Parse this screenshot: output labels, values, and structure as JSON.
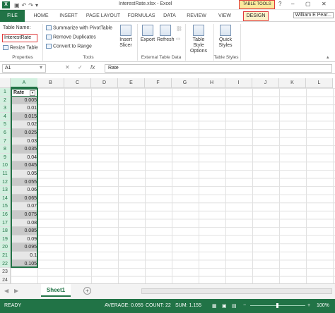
{
  "window": {
    "title": "InterestRate.xlsx - Excel",
    "contextual_tab": "TABLE TOOLS",
    "controls": [
      "?",
      "–",
      "▢",
      "✕"
    ]
  },
  "tabs": [
    "FILE",
    "HOME",
    "INSERT",
    "PAGE LAYOUT",
    "FORMULAS",
    "DATA",
    "REVIEW",
    "VIEW",
    "DESIGN"
  ],
  "user": "William E Pear...",
  "ribbon": {
    "properties": {
      "table_name_label": "Table Name:",
      "table_name_value": "InterestRate",
      "resize_label": "Resize Table",
      "group": "Properties"
    },
    "tools": {
      "summarize": "Summarize with PivotTable",
      "remove_dups": "Remove Duplicates",
      "convert": "Convert to Range",
      "insert_slicer_1": "Insert",
      "insert_slicer_2": "Slicer",
      "group": "Tools"
    },
    "external": {
      "export": "Export",
      "refresh": "Refresh",
      "group": "External Table Data"
    },
    "styles": {
      "options_1": "Table Style",
      "options_2": "Options",
      "quick_1": "Quick",
      "quick_2": "Styles",
      "group": "Table Styles"
    }
  },
  "formula_bar": {
    "name_box": "A1",
    "cancel": "✕",
    "enter": "✓",
    "fx": "fx",
    "formula": "Rate"
  },
  "grid": {
    "columns": [
      "A",
      "B",
      "C",
      "D",
      "E",
      "F",
      "G",
      "H",
      "I",
      "J",
      "K",
      "L"
    ],
    "rows": [
      "1",
      "2",
      "3",
      "4",
      "5",
      "6",
      "7",
      "8",
      "9",
      "10",
      "11",
      "12",
      "13",
      "14",
      "15",
      "16",
      "17",
      "18",
      "19",
      "20",
      "21",
      "22",
      "23",
      "24"
    ],
    "header": "Rate",
    "values": [
      "0.005",
      "0.01",
      "0.015",
      "0.02",
      "0.025",
      "0.03",
      "0.035",
      "0.04",
      "0.045",
      "0.05",
      "0.055",
      "0.06",
      "0.065",
      "0.07",
      "0.075",
      "0.08",
      "0.085",
      "0.09",
      "0.095",
      "0.1",
      "0.105"
    ]
  },
  "sheets": {
    "active": "Sheet1",
    "add": "+"
  },
  "status": {
    "ready": "READY",
    "average": "AVERAGE: 0.055",
    "count": "COUNT: 22",
    "sum": "SUM: 1.155",
    "zoom": "100%"
  },
  "colors": {
    "excel_green": "#217346",
    "highlight_red": "#e03c3c",
    "band_dark": "#c9c9c9",
    "band_light": "#e7e7e7"
  }
}
